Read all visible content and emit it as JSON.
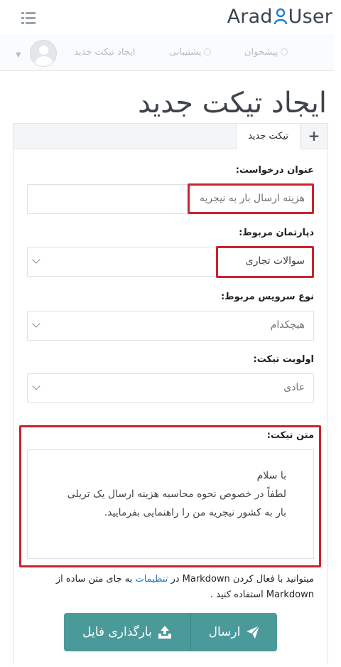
{
  "header": {
    "logo_left": "Arad",
    "logo_right": "User",
    "nav": {
      "suggest": "پیشخوان",
      "support": "پشتیبانی",
      "new_ticket": "ایجاد تیکت جدید"
    }
  },
  "page": {
    "title": "ایجاد تیکت جدید",
    "tab_label": "تیکت جدید",
    "tab_icon": "plus-icon"
  },
  "form": {
    "subject": {
      "label": "عنوان درخواست:",
      "value": "هزینه ارسال بار به نیجریه"
    },
    "department": {
      "label": "دپارتمان مربوط:",
      "value": "سوالات تجاری"
    },
    "service": {
      "label": "نوع سرویس مربوط:",
      "value": "هیچکدام"
    },
    "priority": {
      "label": "اولویت تیکت:",
      "value": "عادی"
    },
    "message": {
      "label": "متن تیکت:",
      "lines": [
        "با سلام",
        "لطفاً در خصوص نحوه محاسبه هزینه ارسال یک تریلی",
        "بار به کشور نیجریه من را راهنمایی بفرمایید."
      ]
    },
    "hint": {
      "part1": "میتوانید با فعال کردن Markdown در ",
      "link": "تنظیمات",
      "part2": " به جای متن ساده از",
      "line2": "Markdown استفاده کنید ."
    },
    "buttons": {
      "send": "ارسال",
      "upload": "بارگذاری فایل"
    }
  },
  "colors": {
    "accent": "#4b9a9a",
    "highlight": "#c8242f",
    "link": "#1f7ac2"
  }
}
